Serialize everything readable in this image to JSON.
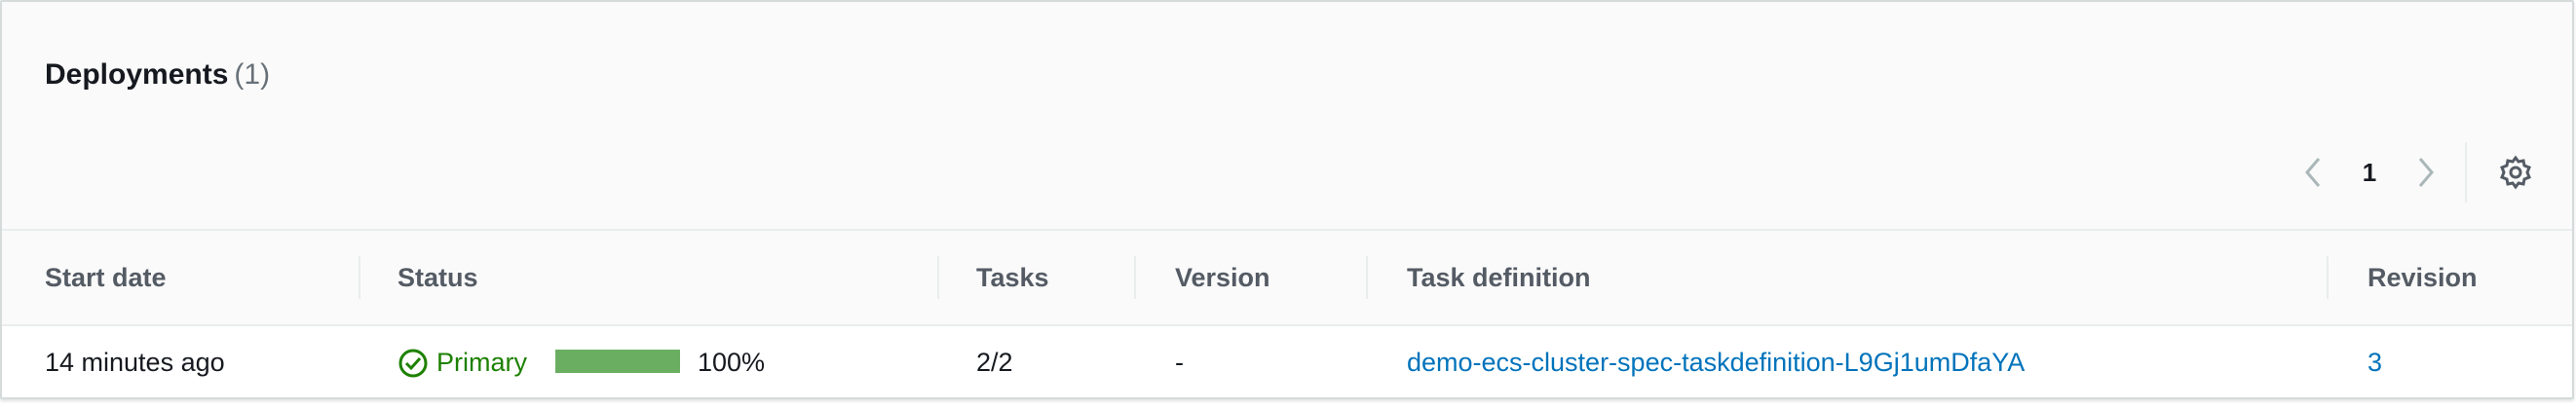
{
  "panel": {
    "title": "Deployments",
    "count": "(1)"
  },
  "pagination": {
    "current_page": "1",
    "prev_icon": "chevron-left-icon",
    "next_icon": "chevron-right-icon",
    "settings_icon": "gear-icon"
  },
  "table": {
    "columns": [
      "Start date",
      "Status",
      "Tasks",
      "Version",
      "Task definition",
      "Revision"
    ],
    "rows": [
      {
        "start_date": "14 minutes ago",
        "status": "Primary",
        "status_icon": "check-circle-icon",
        "progress_fraction": 1.0,
        "progress_label": "100%",
        "tasks": "2/2",
        "version": "-",
        "task_definition": "demo-ecs-cluster-spec-taskdefinition-L9Gj1umDfaYA",
        "revision": "3"
      }
    ]
  },
  "colors": {
    "success": "#1d8102",
    "progress": "#6aaf61",
    "link": "#0073bb"
  }
}
